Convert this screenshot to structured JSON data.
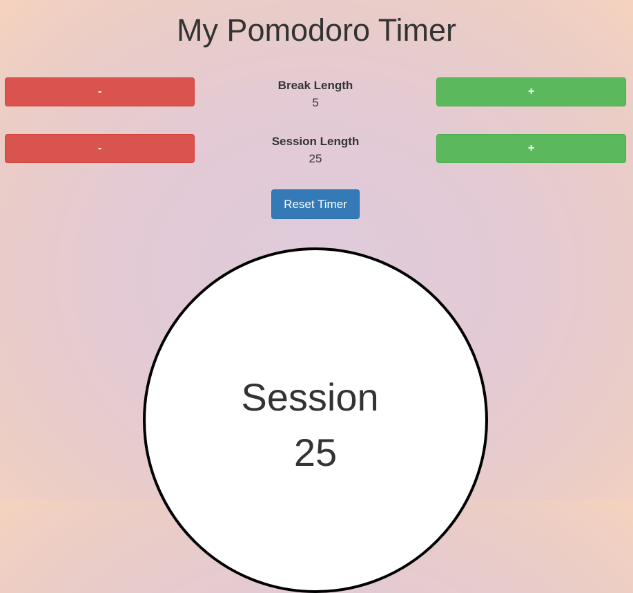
{
  "header": {
    "title": "My Pomodoro Timer"
  },
  "break": {
    "label": "Break Length",
    "value": "5",
    "decrement_label": "-",
    "increment_label": "+"
  },
  "session": {
    "label": "Session Length",
    "value": "25",
    "decrement_label": "-",
    "increment_label": "+"
  },
  "controls": {
    "reset_label": "Reset Timer"
  },
  "clock": {
    "mode_label": "Session",
    "time": "25"
  },
  "colors": {
    "decrement": "#d9534f",
    "increment": "#5cb85c",
    "reset": "#337ab7",
    "clock_face": "#ffffff",
    "clock_border": "#000000"
  }
}
